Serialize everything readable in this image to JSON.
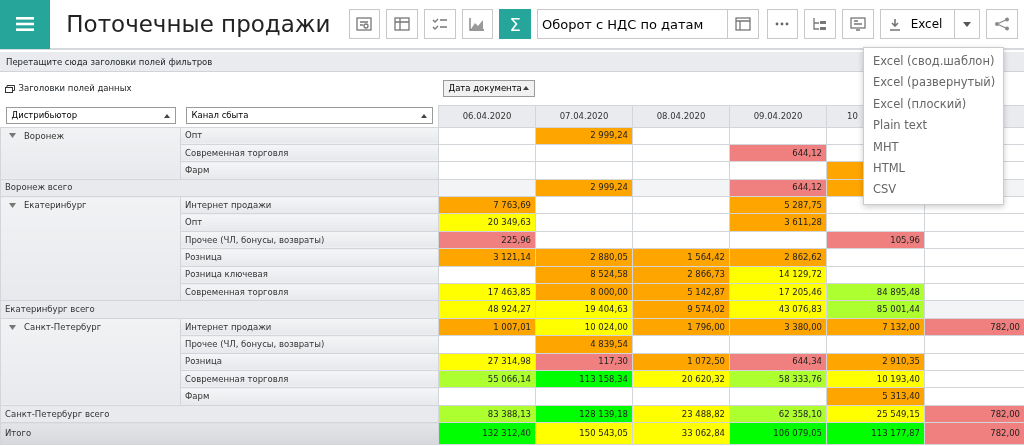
{
  "header": {
    "title": "Поточечные продажи",
    "sum_button": {
      "label": "Σ",
      "selected": true
    },
    "measure_select": {
      "value": "Оборот с НДС по датам"
    },
    "export_button": {
      "label": "Excel"
    }
  },
  "export_menu": {
    "items": [
      "Excel (свод.шаблон)",
      "Excel (развернутый)",
      "Excel (плоский)",
      "Plain text",
      "MHT",
      "HTML",
      "CSV"
    ]
  },
  "filter_area": {
    "hint": "Перетащите сюда заголовки полей фильтров"
  },
  "data_fields": {
    "label": "Заголовки полей данных"
  },
  "column_field": {
    "label": "Дата документа"
  },
  "row_fields": [
    {
      "label": "Дистрибьютор"
    },
    {
      "label": "Канал сбыта"
    }
  ],
  "columns": [
    "06.04.2020",
    "07.04.2020",
    "08.04.2020",
    "09.04.2020",
    "10"
  ],
  "groups": [
    {
      "name": "Воронеж",
      "expanded": true,
      "rows": [
        {
          "label": "Опт",
          "cells": [
            null,
            {
              "value": "2 999,24",
              "color": "#ffa500"
            },
            null,
            null,
            null,
            null
          ]
        },
        {
          "label": "Современная торговля",
          "cells": [
            null,
            null,
            null,
            {
              "value": "644,12",
              "color": "#f08080"
            },
            null,
            null
          ]
        },
        {
          "label": "Фарм",
          "cells": [
            null,
            null,
            null,
            null,
            {
              "color": "#ffa500"
            },
            null
          ]
        }
      ],
      "total": {
        "label": "Воронеж всего",
        "cells": [
          null,
          {
            "value": "2 999,24",
            "color": "#ffa500"
          },
          null,
          {
            "value": "644,12",
            "color": "#f08080"
          },
          {
            "color": "#ffa500"
          },
          null
        ]
      }
    },
    {
      "name": "Екатеринбург",
      "expanded": true,
      "rows": [
        {
          "label": "Интернет продажи",
          "cells": [
            {
              "value": "7 763,69",
              "color": "#ffa500"
            },
            null,
            null,
            {
              "value": "5 287,75",
              "color": "#ffa500"
            },
            null,
            null
          ]
        },
        {
          "label": "Опт",
          "cells": [
            {
              "value": "20 349,63",
              "color": "#ffff00"
            },
            null,
            null,
            {
              "value": "3 611,28",
              "color": "#ffa500"
            },
            null,
            null
          ]
        },
        {
          "label": "Прочее (ЧЛ, бонусы, возвраты)",
          "cells": [
            {
              "value": "225,96",
              "color": "#f08080"
            },
            null,
            null,
            null,
            {
              "value": "105,96",
              "color": "#f08080"
            },
            null
          ]
        },
        {
          "label": "Розница",
          "cells": [
            {
              "value": "3 121,14",
              "color": "#ffa500"
            },
            {
              "value": "2 880,05",
              "color": "#ffa500"
            },
            {
              "value": "1 564,42",
              "color": "#ffa500"
            },
            {
              "value": "2 862,62",
              "color": "#ffa500"
            },
            null,
            null
          ]
        },
        {
          "label": "Розница ключевая",
          "cells": [
            null,
            {
              "value": "8 524,58",
              "color": "#ffa500"
            },
            {
              "value": "2 866,73",
              "color": "#ffa500"
            },
            {
              "value": "14 129,72",
              "color": "#ffff00"
            },
            null,
            null
          ]
        },
        {
          "label": "Современная торговля",
          "cells": [
            {
              "value": "17 463,85",
              "color": "#ffff00"
            },
            {
              "value": "8 000,00",
              "color": "#ffa500"
            },
            {
              "value": "5 142,87",
              "color": "#ffa500"
            },
            {
              "value": "17 205,46",
              "color": "#ffff00"
            },
            {
              "value": "84 895,48",
              "color": "#adff2f"
            },
            null
          ]
        }
      ],
      "total": {
        "label": "Екатеринбург всего",
        "cells": [
          {
            "value": "48 924,27",
            "color": "#ffff00"
          },
          {
            "value": "19 404,63",
            "color": "#ffff00"
          },
          {
            "value": "9 574,02",
            "color": "#ffa500"
          },
          {
            "value": "43 076,83",
            "color": "#ffff00"
          },
          {
            "value": "85 001,44",
            "color": "#adff2f"
          },
          null
        ]
      }
    },
    {
      "name": "Санкт-Петербург",
      "expanded": true,
      "rows": [
        {
          "label": "Интернет продажи",
          "cells": [
            {
              "value": "1 007,01",
              "color": "#ffa500"
            },
            {
              "value": "10 024,00",
              "color": "#ffff00"
            },
            {
              "value": "1 796,00",
              "color": "#ffa500"
            },
            {
              "value": "3 380,00",
              "color": "#ffa500"
            },
            {
              "value": "7 132,00",
              "color": "#ffa500"
            },
            {
              "value": "782,00",
              "color": "#f08080"
            }
          ]
        },
        {
          "label": "Прочее (ЧЛ, бонусы, возвраты)",
          "cells": [
            null,
            {
              "value": "4 839,54",
              "color": "#ffa500"
            },
            null,
            null,
            null,
            null
          ]
        },
        {
          "label": "Розница",
          "cells": [
            {
              "value": "27 314,98",
              "color": "#ffff00"
            },
            {
              "value": "117,30",
              "color": "#f08080"
            },
            {
              "value": "1 072,50",
              "color": "#ffa500"
            },
            {
              "value": "644,34",
              "color": "#f08080"
            },
            {
              "value": "2 910,35",
              "color": "#ffa500"
            },
            null
          ]
        },
        {
          "label": "Современная торговля",
          "cells": [
            {
              "value": "55 066,14",
              "color": "#adff2f"
            },
            {
              "value": "113 158,34",
              "color": "#00ff00"
            },
            {
              "value": "20 620,32",
              "color": "#ffff00"
            },
            {
              "value": "58 333,76",
              "color": "#adff2f"
            },
            {
              "value": "10 193,40",
              "color": "#ffff00"
            },
            null
          ]
        },
        {
          "label": "Фарм",
          "cells": [
            null,
            null,
            null,
            null,
            {
              "value": "5 313,40",
              "color": "#ffa500"
            },
            null
          ]
        }
      ],
      "total": {
        "label": "Санкт-Петербург всего",
        "cells": [
          {
            "value": "83 388,13",
            "color": "#adff2f"
          },
          {
            "value": "128 139,18",
            "color": "#00ff00"
          },
          {
            "value": "23 488,82",
            "color": "#ffff00"
          },
          {
            "value": "62 358,10",
            "color": "#adff2f"
          },
          {
            "value": "25 549,15",
            "color": "#ffff00"
          },
          {
            "value": "782,00",
            "color": "#f08080"
          }
        ]
      }
    }
  ],
  "grand_total": {
    "label": "Итого",
    "cells": [
      {
        "value": "132 312,40",
        "color": "#00ff00"
      },
      {
        "value": "150 543,05",
        "color": "#ffff00"
      },
      {
        "value": "33 062,84",
        "color": "#ffff00"
      },
      {
        "value": "106 079,05",
        "color": "#00ff00"
      },
      {
        "value": "113 177,87",
        "color": "#00ff00"
      },
      {
        "value": "782,00",
        "color": "#f08080"
      }
    ]
  }
}
